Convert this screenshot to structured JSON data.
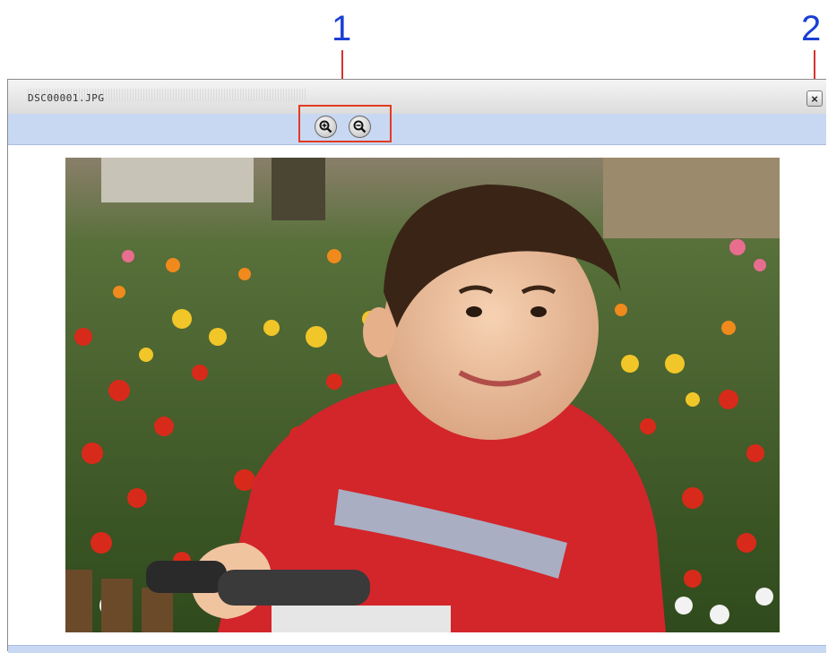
{
  "callouts": {
    "one": "1",
    "two": "2"
  },
  "window": {
    "title": "DSC00001.JPG"
  },
  "toolbar": {
    "zoom_in": "zoom-in-icon",
    "zoom_out": "zoom-out-icon"
  },
  "close": {
    "icon": "close-icon",
    "glyph": "×"
  },
  "colors": {
    "toolbar": "#c9d8f2",
    "callout_text": "#1a3fd6",
    "highlight": "#e33a22"
  }
}
